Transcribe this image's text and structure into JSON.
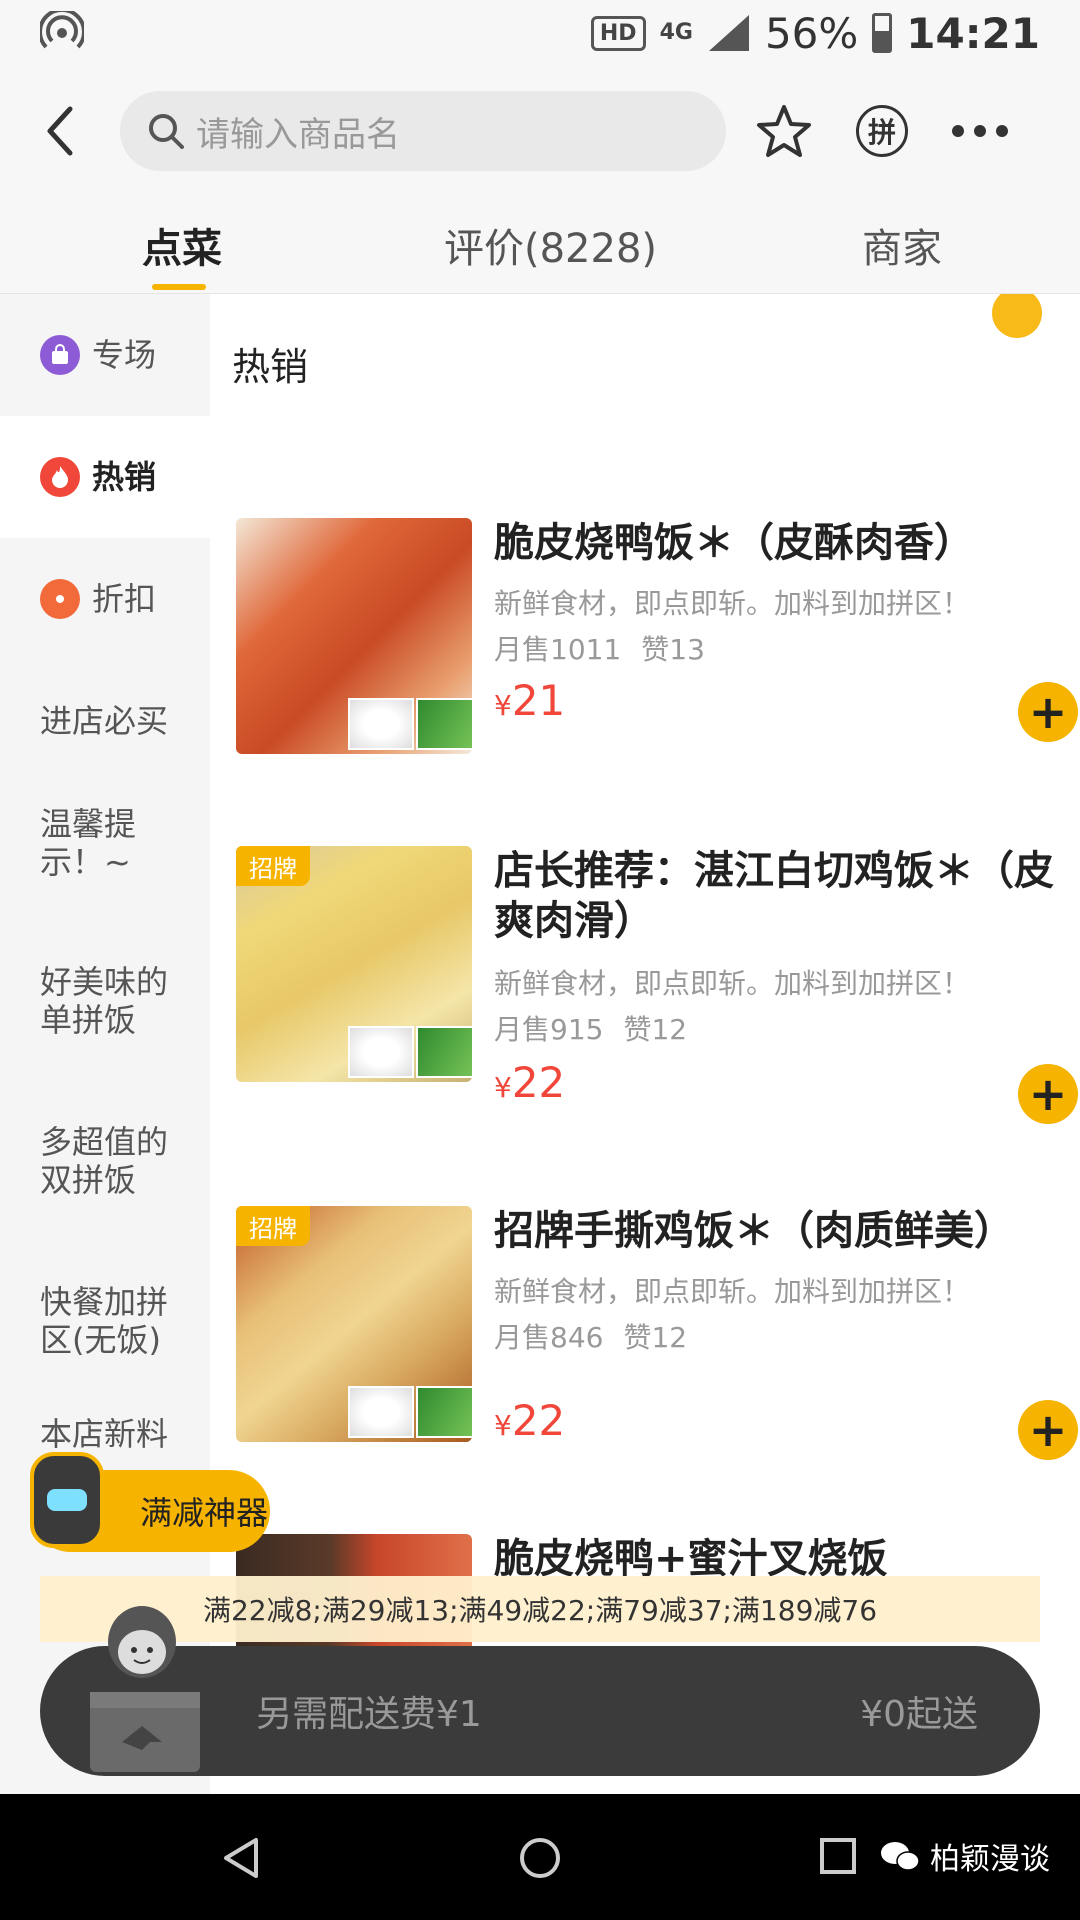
{
  "status": {
    "battery": "56%",
    "time": "14:21",
    "hd": "HD",
    "network": "4G"
  },
  "search": {
    "placeholder": "请输入商品名"
  },
  "nav": {
    "pin_label": "拼"
  },
  "tabs": [
    {
      "label": "点菜",
      "active": true
    },
    {
      "label": "评价(8228)",
      "active": false
    },
    {
      "label": "商家",
      "active": false
    }
  ],
  "sidebar": {
    "items": [
      {
        "label": "专场",
        "icon": "bag-icon",
        "color": "#8e5bd6"
      },
      {
        "label": "热销",
        "icon": "fire-icon",
        "color": "#f0473a",
        "active": true
      },
      {
        "label": "折扣",
        "icon": "discount-tag-icon",
        "color": "#f26a3a"
      },
      {
        "label": "进店必买"
      },
      {
        "label": "温馨提示！~"
      },
      {
        "label": "好美味的单拼饭"
      },
      {
        "label": "多超值的双拼饭"
      },
      {
        "label": "快餐加拼区(无饭)"
      },
      {
        "label": "本店新料"
      }
    ]
  },
  "section": {
    "title": "热销"
  },
  "items": [
    {
      "name": "脆皮烧鸭饭＊（皮酥肉香）",
      "desc": "新鲜食材，即点即斩。加料到加拼区！",
      "sales": "月售1011",
      "likes": "赞13",
      "currency": "¥",
      "price": "21",
      "tag": ""
    },
    {
      "name": "店长推荐：湛江白切鸡饭＊（皮爽肉滑）",
      "desc": "新鲜食材，即点即斩。加料到加拼区！",
      "sales": "月售915",
      "likes": "赞12",
      "currency": "¥",
      "price": "22",
      "tag": "招牌"
    },
    {
      "name": "招牌手撕鸡饭＊（肉质鲜美）",
      "desc": "新鲜食材，即点即斩。加料到加拼区！",
      "sales": "月售846",
      "likes": "赞12",
      "currency": "¥",
      "price": "22",
      "tag": "招牌"
    },
    {
      "name": "脆皮烧鸭+蜜汁叉烧饭",
      "desc": "",
      "sales": "",
      "likes": "",
      "currency": "",
      "price": "",
      "tag": ""
    }
  ],
  "promo": {
    "label": "满减神器"
  },
  "discount": {
    "text": "满22减8;满29减13;满49减22;满79减37;满189减76"
  },
  "cart": {
    "delivery": "另需配送费¥1",
    "minimum": "¥0起送"
  },
  "watermark": {
    "text": "柏颖漫谈"
  },
  "colors": {
    "accent": "#f6b300",
    "price": "#f0473a"
  }
}
